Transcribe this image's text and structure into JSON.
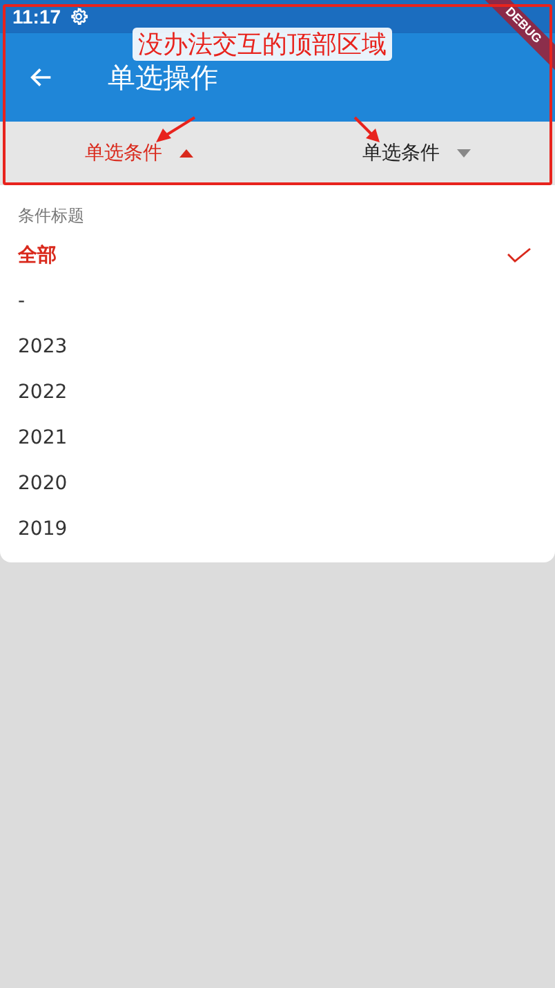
{
  "status_bar": {
    "time": "11:17"
  },
  "debug_banner": {
    "label": "DEBUG"
  },
  "app_bar": {
    "title": "单选操作"
  },
  "filters": [
    {
      "label": "单选条件",
      "selected": true
    },
    {
      "label": "单选条件",
      "selected": false
    }
  ],
  "dropdown": {
    "title": "条件标题",
    "options": [
      {
        "label": "全部",
        "selected": true
      },
      {
        "label": "-",
        "selected": false
      },
      {
        "label": "2023",
        "selected": false
      },
      {
        "label": "2022",
        "selected": false
      },
      {
        "label": "2021",
        "selected": false
      },
      {
        "label": "2020",
        "selected": false
      },
      {
        "label": "2019",
        "selected": false
      }
    ]
  },
  "annotation": {
    "text": "没办法交互的顶部区域"
  }
}
